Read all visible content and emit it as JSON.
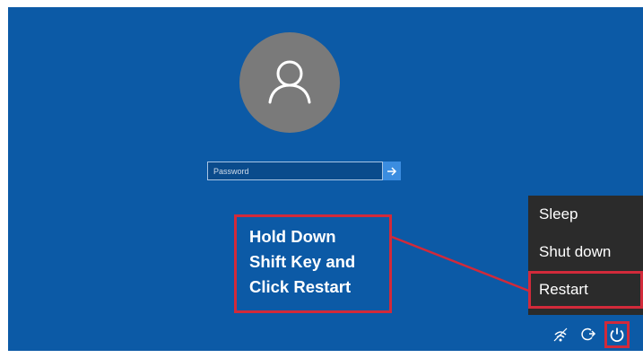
{
  "login": {
    "password_placeholder": "Password"
  },
  "callout": {
    "lines": [
      "Hold Down",
      "Shift Key and",
      "Click Restart"
    ]
  },
  "power_menu": {
    "items": [
      {
        "label": "Sleep"
      },
      {
        "label": "Shut down"
      },
      {
        "label": "Restart"
      }
    ]
  },
  "tray": {
    "icons": [
      "network-icon",
      "ease-of-access-icon",
      "power-icon"
    ]
  },
  "colors": {
    "background": "#0c5aa6",
    "avatar": "#7a7a7a",
    "highlight": "#d22a3a",
    "menu": "#2b2b2b"
  }
}
